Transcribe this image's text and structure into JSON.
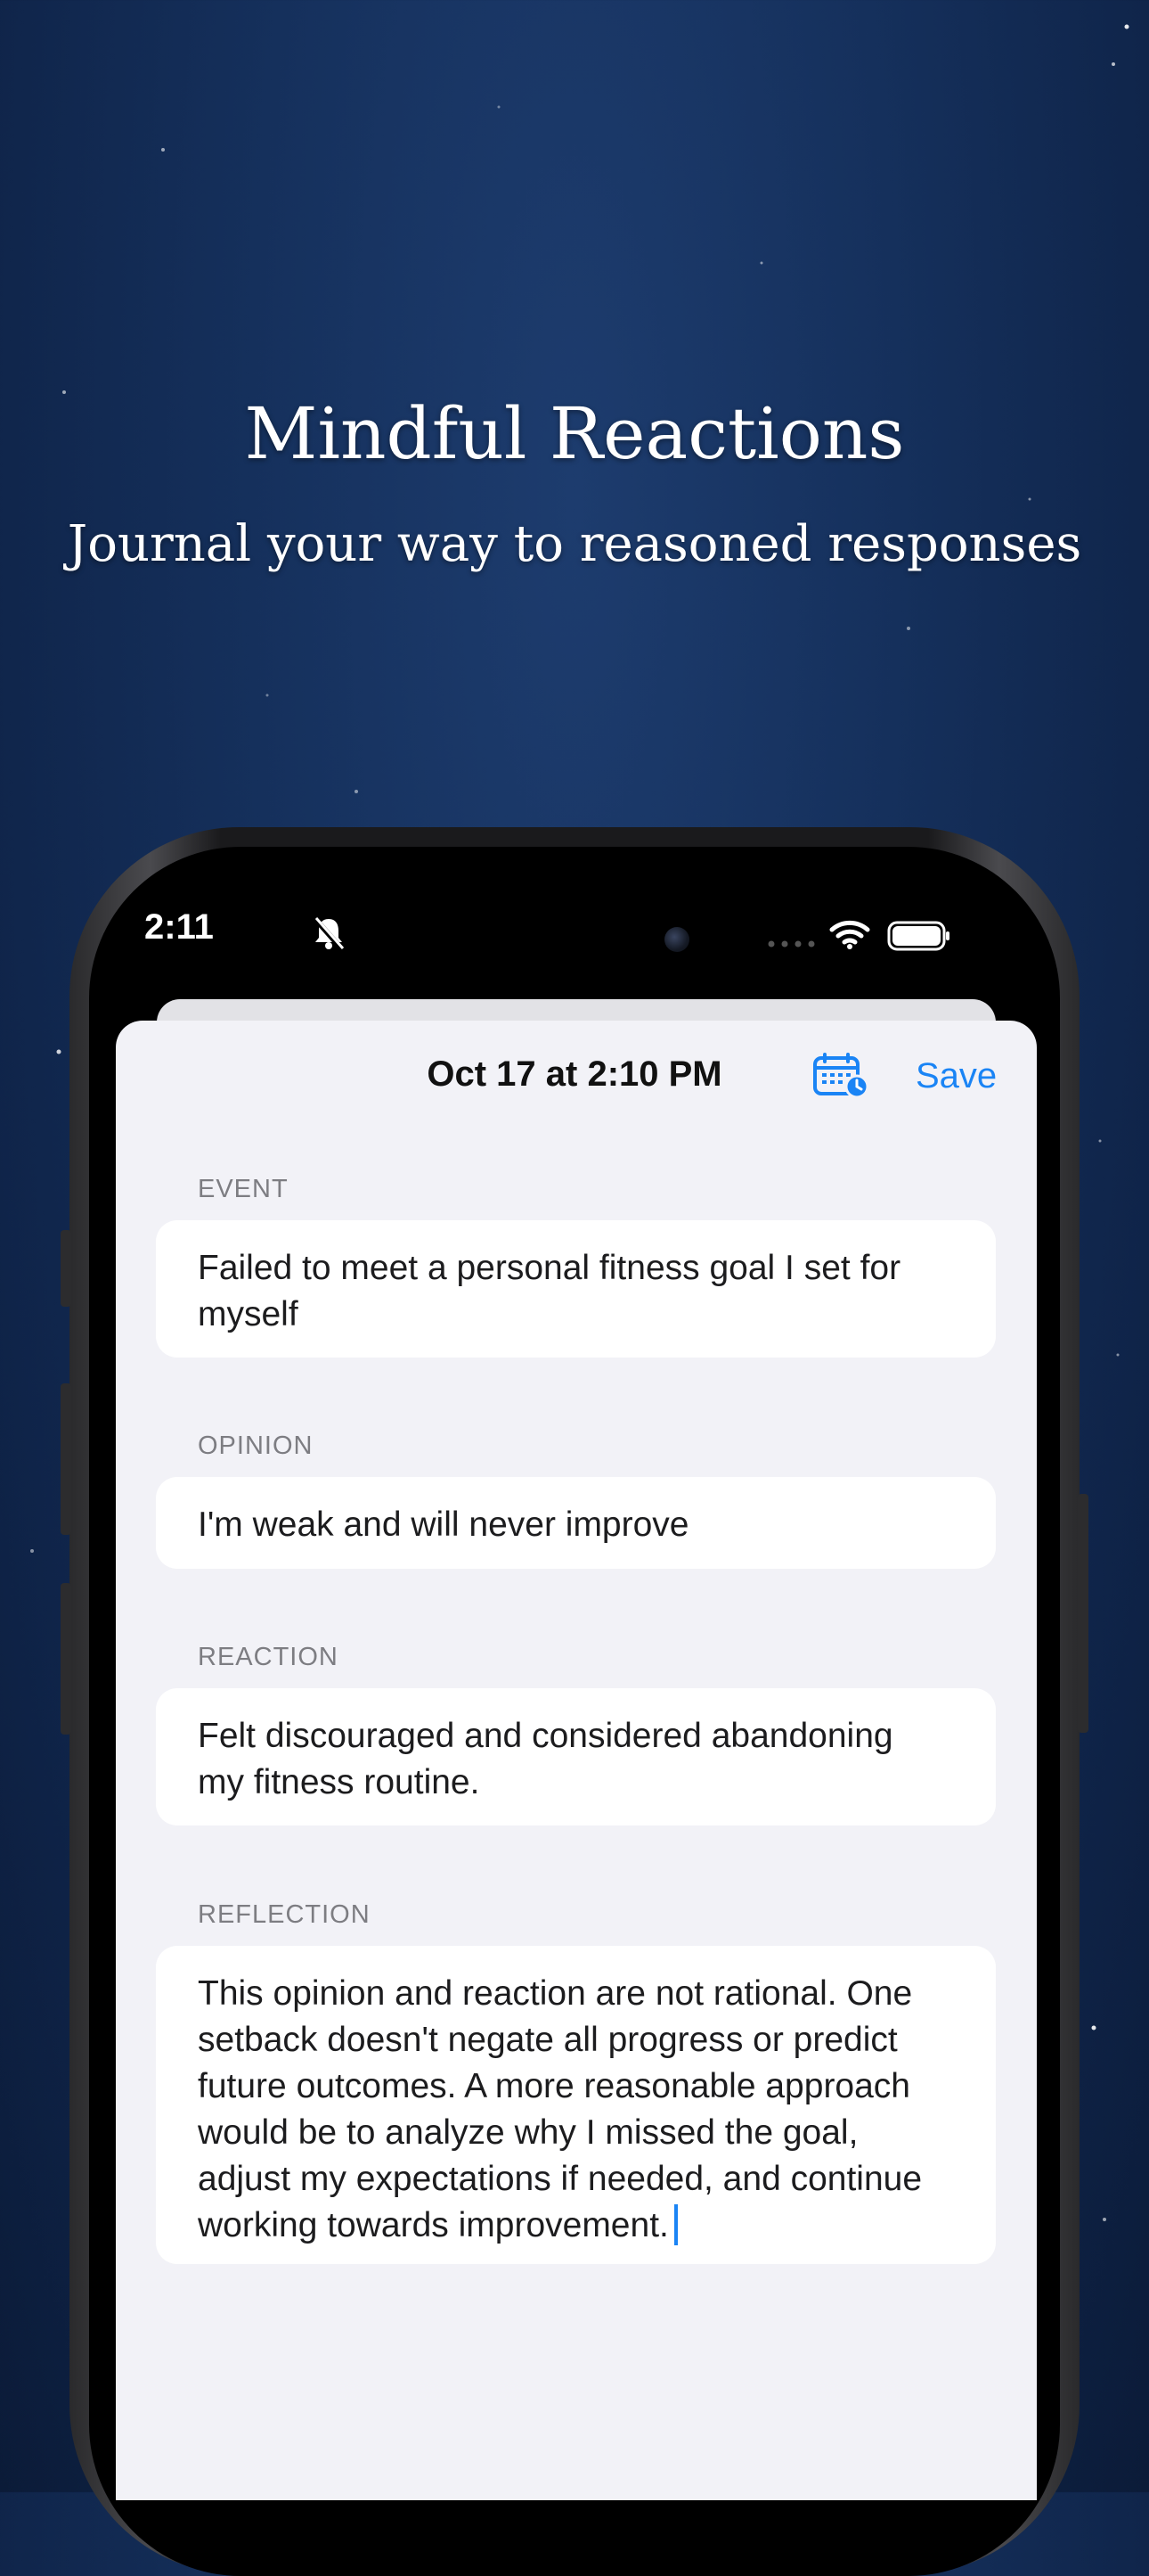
{
  "hero": {
    "title": "Mindful Reactions",
    "subtitle": "Journal your way to reasoned responses"
  },
  "status_bar": {
    "time": "2:11",
    "icons": [
      "bell-slash-icon",
      "camera-icon",
      "signal-icon",
      "wifi-icon",
      "battery-icon"
    ]
  },
  "nav": {
    "title": "Oct 17 at 2:10 PM",
    "calendar_icon": "calendar-clock-icon",
    "save_label": "Save"
  },
  "entry": {
    "event": {
      "label": "EVENT",
      "line1": "Failed to meet a personal fitness goal I set for",
      "line2": "myself"
    },
    "opinion": {
      "label": "OPINION",
      "line1": "I'm weak and will never improve"
    },
    "reaction": {
      "label": "REACTION",
      "line1": "Felt discouraged and considered abandoning",
      "line2": "my fitness routine."
    },
    "reflection": {
      "label": "REFLECTION",
      "line1": "This opinion and reaction are not rational. One",
      "line2": "setback doesn't negate all progress or predict",
      "line3": "future outcomes. A more reasonable approach",
      "line4": "would be to analyze why I missed the goal,",
      "line5": "adjust my expectations if needed, and continue",
      "line6": "working towards improvement."
    }
  },
  "colors": {
    "background": "#15305c",
    "accent": "#1a84f5",
    "sheet": "#f2f2f7",
    "label_gray": "#7d7d82"
  }
}
